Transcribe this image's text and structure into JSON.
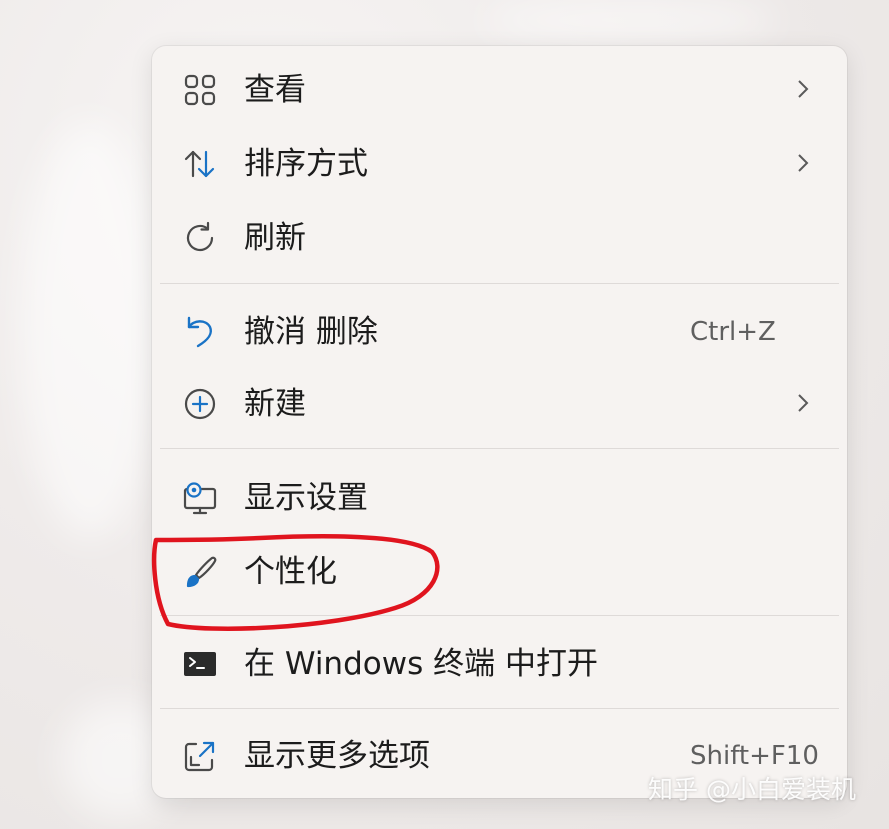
{
  "menu": {
    "items": [
      {
        "label": "查看",
        "icon": "view-grid-icon",
        "has_submenu": true
      },
      {
        "label": "排序方式",
        "icon": "sort-arrows-icon",
        "has_submenu": true
      },
      {
        "label": "刷新",
        "icon": "refresh-icon",
        "has_submenu": false
      },
      {
        "label": "撤消 删除",
        "icon": "undo-icon",
        "shortcut": "Ctrl+Z"
      },
      {
        "label": "新建",
        "icon": "new-plus-icon",
        "has_submenu": true
      },
      {
        "label": "显示设置",
        "icon": "display-settings-icon"
      },
      {
        "label": "个性化",
        "icon": "brush-icon"
      },
      {
        "label": "在 Windows 终端 中打开",
        "icon": "terminal-icon"
      },
      {
        "label": "显示更多选项",
        "icon": "more-options-icon",
        "shortcut": "Shift+F10"
      }
    ]
  },
  "annotation": {
    "color": "#e0141e",
    "target": "个性化"
  },
  "watermark": "知乎 @小白爱装机",
  "colors": {
    "accent_blue": "#1a73c6",
    "menu_bg": "#f6f3f1",
    "text": "#1c1c1c",
    "shortcut_text": "#5f5f5f",
    "icon_gray": "#4a4a4a"
  }
}
